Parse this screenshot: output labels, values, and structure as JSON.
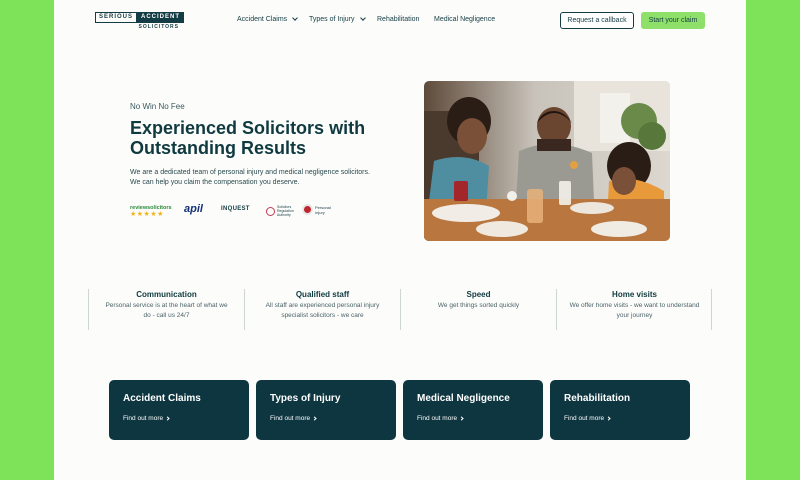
{
  "logo": {
    "word1": "SERIOUS",
    "word2": "ACCIDENT",
    "sub": "SOLICITORS"
  },
  "nav": {
    "items": [
      {
        "label": "Accident Claims"
      },
      {
        "label": "Types of Injury"
      },
      {
        "label": "Rehabilitation"
      },
      {
        "label": "Medical Negligence"
      }
    ]
  },
  "header": {
    "callback_label": "Request a callback",
    "claim_label": "Start your claim"
  },
  "hero": {
    "eyebrow": "No Win No Fee",
    "headline": "Experienced Solicitors with Outstanding Results",
    "description": "We are a dedicated team of personal injury and medical negligence solicitors. We can help you claim the compensation you deserve.",
    "badges": {
      "reviews": "reviewsolicitors",
      "stars": "★★★★★",
      "apil": "apil",
      "inquest": "INQUEST",
      "sra": "Solicitors Regulation Authority",
      "pi": "Personal Injury"
    }
  },
  "features": [
    {
      "title": "Communication",
      "body": "Personal service is at the heart of what we do -  call us 24/7"
    },
    {
      "title": "Qualified staff",
      "body": "All staff are experienced personal injury specialist solicitors - we care"
    },
    {
      "title": "Speed",
      "body": "We get things sorted quickly"
    },
    {
      "title": "Home visits",
      "body": "We offer home visits - we want to understand your journey"
    }
  ],
  "cards": [
    {
      "title": "Accident Claims",
      "link": "Find out more"
    },
    {
      "title": "Types of Injury",
      "link": "Find out more"
    },
    {
      "title": "Medical Negligence",
      "link": "Find out more"
    },
    {
      "title": "Rehabilitation",
      "link": "Find out more"
    }
  ],
  "colors": {
    "brand": "#0e3640",
    "accent": "#8ee06a",
    "frame": "#7fe35a"
  }
}
